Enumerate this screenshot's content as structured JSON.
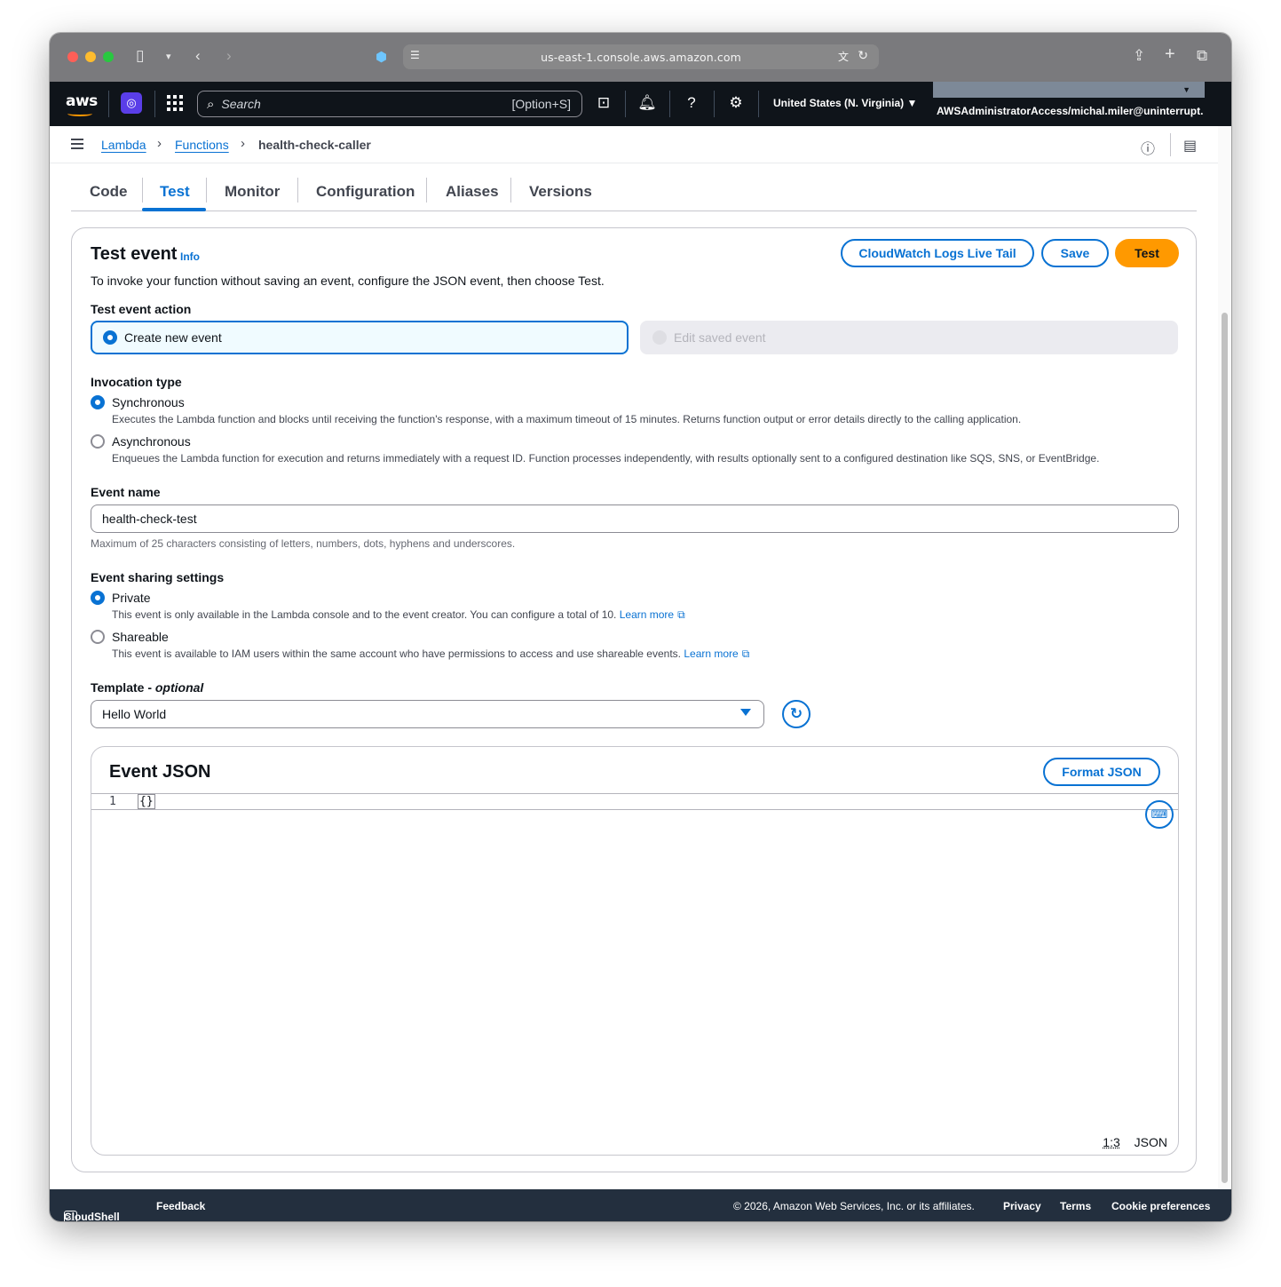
{
  "browser": {
    "url": "us-east-1.console.aws.amazon.com"
  },
  "header": {
    "logo": "aws",
    "search_placeholder": "Search",
    "search_shortcut": "[Option+S]",
    "region": "United States (N. Virginia)",
    "account": "AWSAdministratorAccess/michal.miler@uninterrupt..."
  },
  "breadcrumb": {
    "items": [
      "Lambda",
      "Functions",
      "health-check-caller"
    ]
  },
  "tabs": [
    "Code",
    "Test",
    "Monitor",
    "Configuration",
    "Aliases",
    "Versions"
  ],
  "active_tab": "Test",
  "test_event": {
    "title": "Test event",
    "info": "Info",
    "description": "To invoke your function without saving an event, configure the JSON event, then choose Test.",
    "buttons": {
      "live_tail": "CloudWatch Logs Live Tail",
      "save": "Save",
      "test": "Test"
    },
    "action_label": "Test event action",
    "action_options": {
      "create": "Create new event",
      "edit": "Edit saved event"
    },
    "invocation_label": "Invocation type",
    "invocation": {
      "sync_label": "Synchronous",
      "sync_desc": "Executes the Lambda function and blocks until receiving the function's response, with a maximum timeout of 15 minutes. Returns function output or error details directly to the calling application.",
      "async_label": "Asynchronous",
      "async_desc": "Enqueues the Lambda function for execution and returns immediately with a request ID. Function processes independently, with results optionally sent to a configured destination like SQS, SNS, or EventBridge."
    },
    "event_name_label": "Event name",
    "event_name_value": "health-check-test",
    "event_name_hint": "Maximum of 25 characters consisting of letters, numbers, dots, hyphens and underscores.",
    "sharing_label": "Event sharing settings",
    "sharing": {
      "private_label": "Private",
      "private_desc": "This event is only available in the Lambda console and to the event creator. You can configure a total of 10.",
      "shareable_label": "Shareable",
      "shareable_desc": "This event is available to IAM users within the same account who have permissions to access and use shareable events.",
      "learn_more": "Learn more"
    },
    "template_label": "Template - ",
    "template_optional": "optional",
    "template_value": "Hello World",
    "json": {
      "title": "Event JSON",
      "format_button": "Format JSON",
      "line_number": "1",
      "code": "{}",
      "position": "1:3",
      "mode": "JSON"
    }
  },
  "footer": {
    "cloudshell": "CloudShell",
    "feedback": "Feedback",
    "copyright": "© 2026, Amazon Web Services, Inc. or its affiliates.",
    "privacy": "Privacy",
    "terms": "Terms",
    "cookie": "Cookie preferences"
  },
  "colors": {
    "accent": "#0972d3",
    "primary_button": "#ff9900",
    "header_bg": "#0f141a",
    "footer_bg": "#232f3e"
  }
}
